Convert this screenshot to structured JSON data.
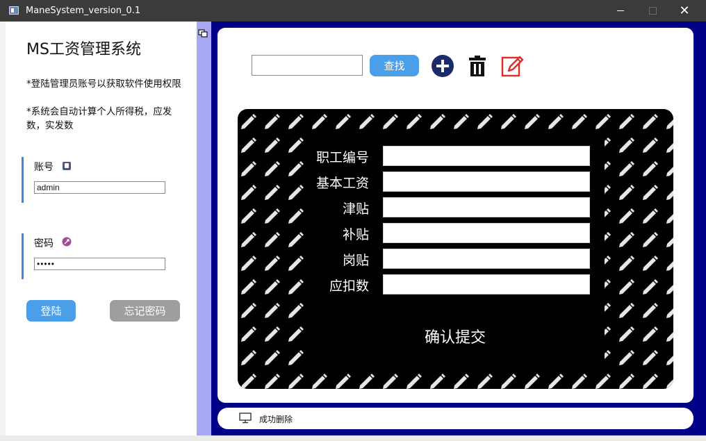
{
  "window": {
    "title": "ManeSystem_version_0.1"
  },
  "login": {
    "heading": "MS工资管理系统",
    "note1": "*登陆管理员账号以获取软件使用权限",
    "note2": "*系统会自动计算个人所得税，应发数，实发数",
    "account_label": "账号",
    "account_value": "admin",
    "password_label": "密码",
    "password_value": "•••••",
    "login_button": "登陆",
    "forgot_button": "忘记密码"
  },
  "toolbar": {
    "search_value": "",
    "search_button": "查找",
    "icons": [
      "add-icon",
      "trash-icon",
      "edit-icon"
    ]
  },
  "form": {
    "labels": [
      "职工编号",
      "基本工资",
      "津贴",
      "补贴",
      "岗贴",
      "应扣数"
    ],
    "values": [
      "",
      "",
      "",
      "",
      "",
      ""
    ],
    "submit": "确认提交"
  },
  "status": {
    "message": "成功删除"
  },
  "colors": {
    "accent": "#3a87e0",
    "button_blue": "#4b9ee8",
    "button_gray": "#9e9e9e",
    "right_background": "#000087",
    "splitter": "#a7a7f4",
    "add_icon": "#1b2a6b",
    "edit_icon": "#d9322b"
  }
}
